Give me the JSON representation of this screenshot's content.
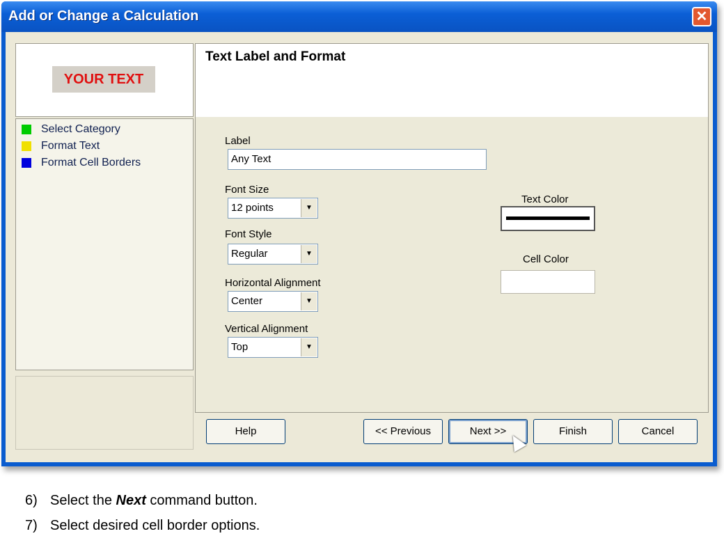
{
  "window": {
    "title": "Add or Change a Calculation",
    "close_glyph": "✕"
  },
  "preview": {
    "sample_text": "YOUR TEXT"
  },
  "steps": [
    {
      "label": "Select Category",
      "color": "#00cc00"
    },
    {
      "label": "Format Text",
      "color": "#f0e000"
    },
    {
      "label": "Format Cell Borders",
      "color": "#0000dd"
    }
  ],
  "panel": {
    "title": "Text Label and Format",
    "label_caption": "Label",
    "label_value": "Any Text",
    "font_size_caption": "Font Size",
    "font_size_value": "12 points",
    "font_style_caption": "Font Style",
    "font_style_value": "Regular",
    "h_align_caption": "Horizontal Alignment",
    "h_align_value": "Center",
    "v_align_caption": "Vertical Alignment",
    "v_align_value": "Top",
    "text_color_caption": "Text Color",
    "cell_color_caption": "Cell Color",
    "dropdown_glyph": "▼"
  },
  "buttons": {
    "help": "Help",
    "previous": "<< Previous",
    "next": "Next >>",
    "finish": "Finish",
    "cancel": "Cancel"
  },
  "instructions": [
    {
      "num": "6)",
      "pre": "Select the ",
      "bold": "Next",
      "post": " command button."
    },
    {
      "num": "7)",
      "pre": "Select desired cell border options.",
      "bold": "",
      "post": ""
    }
  ]
}
